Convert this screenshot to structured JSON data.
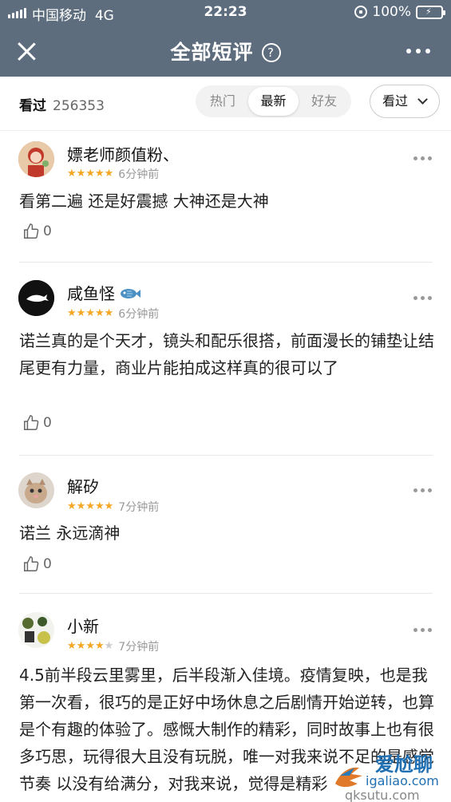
{
  "status": {
    "carrier": "中国移动",
    "network": "4G",
    "time": "22:23",
    "battery": "100%"
  },
  "nav": {
    "title": "全部短评",
    "help": "?"
  },
  "filter": {
    "watched_label": "看过",
    "watched_count": "256353",
    "tabs": [
      {
        "label": "热门",
        "active": false
      },
      {
        "label": "最新",
        "active": true
      },
      {
        "label": "好友",
        "active": false
      }
    ],
    "dropdown": "看过"
  },
  "comments": [
    {
      "name": "嫖老师颜值粉、",
      "stars": 5,
      "time": "6分钟前",
      "text": "看第二遍 还是好震撼 大神还是大神",
      "likes": "0"
    },
    {
      "name": "咸鱼怪",
      "stars": 5,
      "time": "6分钟前",
      "text": "诺兰真的是个天才，镜头和配乐很搭，前面漫长的铺垫让结尾更有力量，商业片能拍成这样真的很可以了",
      "likes": "0"
    },
    {
      "name": "解矽",
      "stars": 5,
      "time": "7分钟前",
      "text": "诺兰 永远滴神",
      "likes": "0"
    },
    {
      "name": "小新",
      "stars": 4,
      "time": "7分钟前",
      "text": "4.5前半段云里雾里，后半段渐入佳境。疫情复映，也是我第一次看，很巧的是正好中场休息之后剧情开始逆转，也算是个有趣的体验了。感慨大制作的精彩，同时故事上也有很多巧思，玩得很大且没有玩脱，唯一对我来说不足的是感觉节奏 以没有给满分，对我来说，觉得是精彩",
      "likes": ""
    }
  ],
  "watermark": {
    "brand": "爱尬聊",
    "url": "igaliao.com",
    "sub": "qksutu.com"
  },
  "colors": {
    "header": "#5d6d7e",
    "star": "#f5a623",
    "accent_battery": "#4cd964"
  }
}
